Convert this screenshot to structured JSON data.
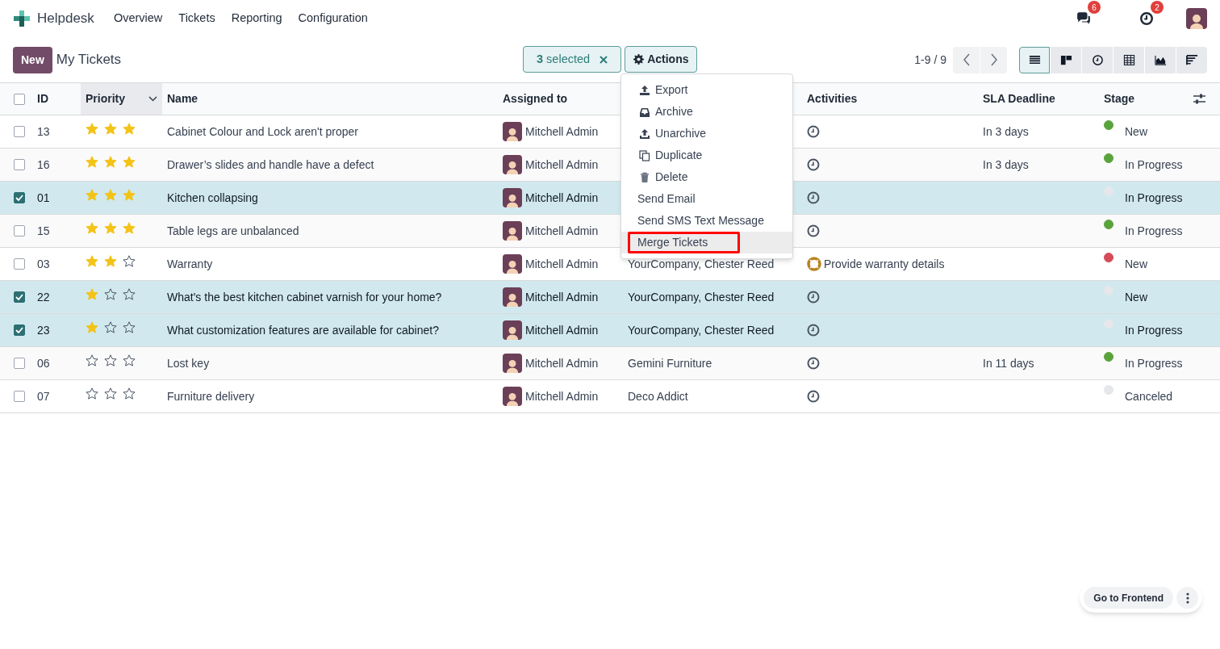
{
  "navbar": {
    "app": "Helpdesk",
    "menu": [
      "Overview",
      "Tickets",
      "Reporting",
      "Configuration"
    ],
    "messages_badge": "6",
    "activities_badge": "2"
  },
  "control_panel": {
    "new_button": "New",
    "title": "My Tickets",
    "selection": "**3** selected",
    "actions_button": "Actions",
    "pager": "1-9 / 9",
    "views": [
      {
        "kind": "list",
        "selected": true
      },
      {
        "kind": "kanban",
        "selected": false
      },
      {
        "kind": "activity",
        "selected": false
      },
      {
        "kind": "pivot",
        "selected": false
      },
      {
        "kind": "graph",
        "selected": false
      },
      {
        "kind": "cohort",
        "selected": false
      }
    ]
  },
  "actions_menu": [
    {
      "kind": "export",
      "label": "Export",
      "highlighted": false
    },
    {
      "kind": "archive",
      "label": "Archive",
      "highlighted": false
    },
    {
      "kind": "unarchive",
      "label": "Unarchive",
      "highlighted": false
    },
    {
      "kind": "duplicate",
      "label": "Duplicate",
      "highlighted": false
    },
    {
      "kind": "delete",
      "label": "Delete",
      "highlighted": false
    },
    {
      "kind": "plain",
      "label": "Send Email",
      "highlighted": false
    },
    {
      "kind": "plain",
      "label": "Send SMS Text Message",
      "highlighted": false
    },
    {
      "kind": "plain",
      "label": "Merge Tickets",
      "highlighted": true
    }
  ],
  "table": {
    "all_selected": false,
    "columns": [
      "ID",
      "Priority",
      "Name",
      "Assigned to",
      "Activities",
      "SLA Deadline",
      "Stage"
    ],
    "rows": [
      {
        "selected": false,
        "id": "13",
        "stars": 3,
        "name": "Cabinet Colour and Lock aren't proper",
        "assigned_to": "Mitchell Admin",
        "sla_deadline": "In 3 days",
        "color": "#5aa33c",
        "stage": "New"
      },
      {
        "selected": false,
        "id": "16",
        "stars": 3,
        "name": "Drawer’s slides and handle have a defect",
        "assigned_to": "Mitchell Admin",
        "sla_deadline": "In 3 days",
        "color": "#5aa33c",
        "stage": "In Progress"
      },
      {
        "selected": true,
        "id": "01",
        "stars": 3,
        "name": "Kitchen collapsing",
        "assigned_to": "Mitchell Admin",
        "color": "#e5e7eb",
        "stage": "In Progress"
      },
      {
        "selected": false,
        "id": "15",
        "stars": 3,
        "name": "Table legs are unbalanced",
        "assigned_to": "Mitchell Admin",
        "color": "#5aa33c",
        "stage": "In Progress"
      },
      {
        "selected": false,
        "id": "03",
        "stars": 2,
        "name": "Warranty",
        "assigned_to": "Mitchell Admin",
        "customer": "YourCompany, Chester Reed",
        "activity": "Provide warranty details",
        "color": "#d44c59",
        "stage": "New"
      },
      {
        "selected": true,
        "id": "22",
        "stars": 1,
        "name": "What's the best kitchen cabinet varnish for your home?",
        "assigned_to": "Mitchell Admin",
        "customer": "YourCompany, Chester Reed",
        "color": "#e5e7eb",
        "stage": "New"
      },
      {
        "selected": true,
        "id": "23",
        "stars": 1,
        "name": "What customization features are available for cabinet?",
        "assigned_to": "Mitchell Admin",
        "customer": "YourCompany, Chester Reed",
        "color": "#e5e7eb",
        "stage": "In Progress"
      },
      {
        "selected": false,
        "id": "06",
        "stars": 0,
        "name": "Lost key",
        "assigned_to": "Mitchell Admin",
        "customer": "Gemini Furniture",
        "sla_deadline": "In 11 days",
        "color": "#5aa33c",
        "stage": "In Progress"
      },
      {
        "selected": false,
        "id": "07",
        "stars": 0,
        "name": "Furniture delivery",
        "assigned_to": "Mitchell Admin",
        "customer": "Deco Addict",
        "color": "#e5e7eb",
        "stage": "Canceled"
      }
    ]
  },
  "frontend_button": "Go to Frontend"
}
